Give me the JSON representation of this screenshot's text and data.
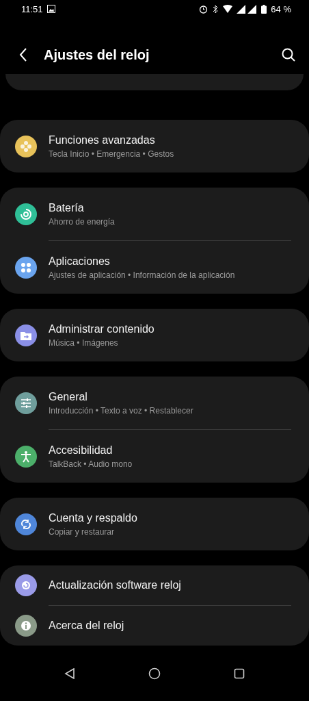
{
  "status_bar": {
    "time": "11:51",
    "battery": "64 %"
  },
  "header": {
    "title": "Ajustes del reloj"
  },
  "groups": [
    {
      "items": [
        {
          "title": "Funciones avanzadas",
          "subtitle": "Tecla Inicio • Emergencia • Gestos",
          "color": "#e8c25a"
        }
      ]
    },
    {
      "items": [
        {
          "title": "Batería",
          "subtitle": "Ahorro de energía",
          "color": "#2fbf97"
        },
        {
          "title": "Aplicaciones",
          "subtitle": "Ajustes de aplicación • Información de la aplicación",
          "color": "#6aa4ee"
        }
      ]
    },
    {
      "items": [
        {
          "title": "Administrar contenido",
          "subtitle": "Música • Imágenes",
          "color": "#8a8fe6"
        }
      ]
    },
    {
      "items": [
        {
          "title": "General",
          "subtitle": "Introducción • Texto a voz • Restablecer",
          "color": "#6f9e9c"
        },
        {
          "title": "Accesibilidad",
          "subtitle": "TalkBack • Audio mono",
          "color": "#4caf6a"
        }
      ]
    },
    {
      "items": [
        {
          "title": "Cuenta y respaldo",
          "subtitle": "Copiar y restaurar",
          "color": "#4f86d9"
        }
      ]
    },
    {
      "items": [
        {
          "title": "Actualización software reloj",
          "color": "#9a9be8"
        },
        {
          "title": "Acerca del reloj",
          "color": "#8a9a88"
        }
      ]
    }
  ]
}
